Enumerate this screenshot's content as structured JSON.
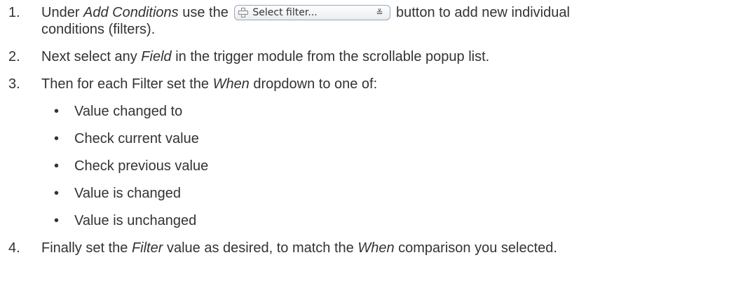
{
  "steps": [
    {
      "number": "1.",
      "before": "Under ",
      "em": "Add Conditions",
      "middle": " use the ",
      "button_label": "Select filter...",
      "after": " button to add new individual",
      "continuation": "conditions (filters)."
    },
    {
      "number": "2.",
      "before": "Next select any ",
      "em": "Field",
      "after": " in the trigger module from the scrollable popup list."
    },
    {
      "number": "3.",
      "before": "Then for each Filter set the ",
      "em": "When",
      "after": " dropdown to one of:",
      "options": [
        "Value changed to",
        "Check current value",
        "Check previous value",
        "Value is changed",
        "Value is unchanged"
      ]
    },
    {
      "number": "4.",
      "before": "Finally set the ",
      "em": "Filter",
      "middle": " value as desired, to match the ",
      "em2": "When",
      "after": " comparison you selected."
    }
  ],
  "bullet_glyph": "•",
  "button_icon": "plus-icon",
  "button_chevron": "chevron-double-down-icon",
  "colors": {
    "text": "#333333",
    "button_border": "#9aa7b8"
  }
}
